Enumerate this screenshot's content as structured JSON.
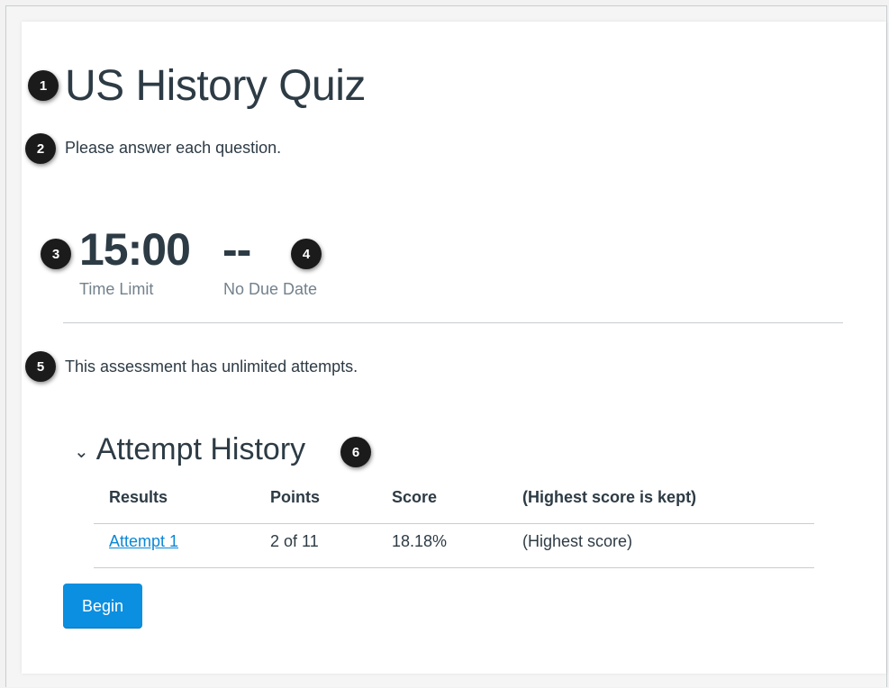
{
  "quiz": {
    "title": "US History Quiz",
    "instructions": "Please answer each question."
  },
  "stats": {
    "time_limit_value": "15:00",
    "time_limit_label": "Time Limit",
    "due_date_value": "--",
    "due_date_label": "No Due Date"
  },
  "attempts_text": "This assessment has unlimited attempts.",
  "history": {
    "title": "Attempt History",
    "columns": [
      "Results",
      "Points",
      "Score",
      "(Highest score is kept)"
    ],
    "rows": [
      {
        "result": "Attempt 1",
        "points": "2 of 11",
        "score": "18.18%",
        "note": "(Highest score)"
      }
    ]
  },
  "begin_label": "Begin",
  "badges": [
    "1",
    "2",
    "3",
    "4",
    "5",
    "6"
  ],
  "colors": {
    "accent": "#0b8fe0",
    "link": "#0b87d6",
    "text": "#2d3b45",
    "muted": "#73818c",
    "badge": "#1b1b1b"
  }
}
